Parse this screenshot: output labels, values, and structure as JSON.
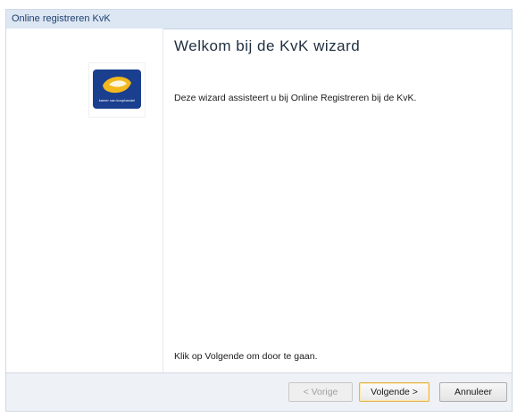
{
  "window": {
    "title": "Online registreren KvK"
  },
  "logo": {
    "tagline": "kamer van koophandel"
  },
  "content": {
    "heading": "Welkom bij de KvK wizard",
    "intro": "Deze wizard assisteert u bij Online Registreren bij de KvK.",
    "instruction": "Klik op Volgende om door te gaan."
  },
  "buttons": {
    "previous": "< Vorige",
    "next": "Volgende >",
    "cancel": "Annuleer"
  },
  "colors": {
    "titlebar": "#dde7f3",
    "logo_bg": "#1a3f8f",
    "logo_accent": "#f2b81d"
  }
}
